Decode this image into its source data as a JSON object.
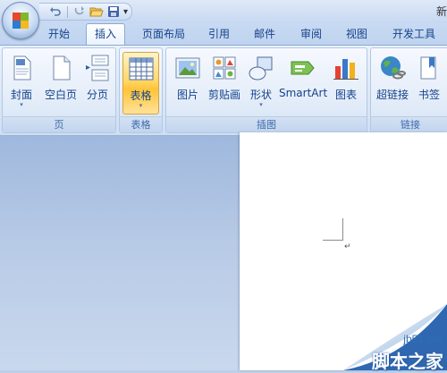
{
  "quick_access": {
    "more_label": "▾"
  },
  "window": {
    "title_fragment": "新"
  },
  "tabs": [
    {
      "label": "开始"
    },
    {
      "label": "插入"
    },
    {
      "label": "页面布局"
    },
    {
      "label": "引用"
    },
    {
      "label": "邮件"
    },
    {
      "label": "审阅"
    },
    {
      "label": "视图"
    },
    {
      "label": "开发工具"
    }
  ],
  "active_tab": "插入",
  "ribbon": {
    "groups": {
      "pages": {
        "label": "页",
        "buttons": [
          {
            "label": "封面",
            "icon": "cover-page-icon"
          },
          {
            "label": "空白页",
            "icon": "blank-page-icon"
          },
          {
            "label": "分页",
            "icon": "page-break-icon"
          }
        ]
      },
      "tables": {
        "label": "表格",
        "buttons": [
          {
            "label": "表格",
            "icon": "table-icon"
          }
        ]
      },
      "illustrations": {
        "label": "插图",
        "buttons": [
          {
            "label": "图片",
            "icon": "picture-icon"
          },
          {
            "label": "剪贴画",
            "icon": "clip-art-icon"
          },
          {
            "label": "形状",
            "icon": "shapes-icon"
          },
          {
            "label": "SmartArt",
            "icon": "smartart-icon"
          },
          {
            "label": "图表",
            "icon": "chart-icon"
          }
        ]
      },
      "links": {
        "label": "链接",
        "buttons": [
          {
            "label": "超链接",
            "icon": "hyperlink-icon"
          },
          {
            "label": "书签",
            "icon": "bookmark-icon"
          }
        ]
      }
    },
    "dropdown_arrow": "▾"
  },
  "document": {
    "paragraph_mark": "↵"
  },
  "watermark": {
    "site": "jb51.net",
    "name": "脚本之家"
  },
  "colors": {
    "accent_text": "#15428b",
    "active_button": "#ffd86b"
  }
}
